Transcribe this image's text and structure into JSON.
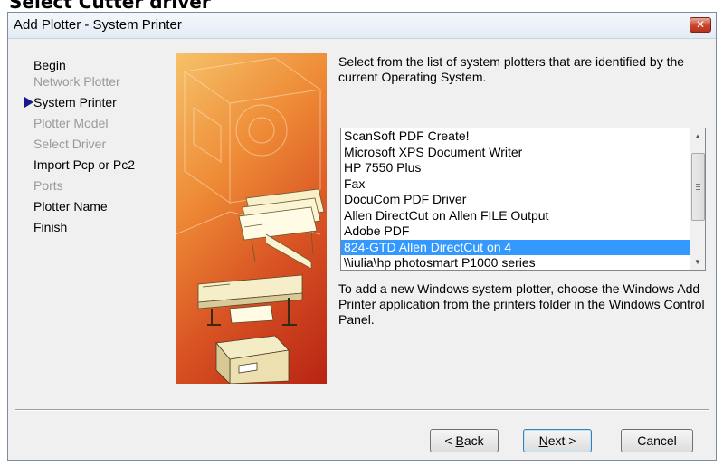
{
  "page_heading": "Select Cutter driver",
  "window": {
    "title": "Add Plotter - System Printer",
    "close_glyph": "✕"
  },
  "steps": [
    {
      "label": "Begin",
      "state": "active"
    },
    {
      "label": "Network Plotter",
      "state": "inactive"
    },
    {
      "label": "System Printer",
      "state": "current"
    },
    {
      "label": "Plotter Model",
      "state": "inactive"
    },
    {
      "label": "Select Driver",
      "state": "inactive"
    },
    {
      "label": "Import Pcp or Pc2",
      "state": "active"
    },
    {
      "label": "Ports",
      "state": "inactive"
    },
    {
      "label": "Plotter Name",
      "state": "active"
    },
    {
      "label": "Finish",
      "state": "active"
    }
  ],
  "intro_text": "Select from the list of system plotters that are identified by the current Operating System.",
  "plotter_list": {
    "items": [
      "ScanSoft PDF Create!",
      "Microsoft XPS Document Writer",
      "HP 7550 Plus",
      "Fax",
      "DocuCom PDF Driver",
      "Allen DirectCut on Allen FILE Output",
      "Adobe PDF",
      "824-GTD Allen DirectCut on 4",
      "\\\\iulia\\hp photosmart P1000 series"
    ],
    "selected": "824-GTD Allen DirectCut on 4"
  },
  "note_text": "To add a new Windows system plotter, choose the Windows Add Printer application from the printers folder in the Windows Control Panel.",
  "buttons": {
    "back_mnemonic": "B",
    "back_rest": "ack",
    "back_prefix": "< ",
    "next_mnemonic": "N",
    "next_rest": "ext >",
    "cancel": "Cancel"
  },
  "colors": {
    "selection": "#3399ff",
    "art_gradient": [
      "#f6c26a",
      "#b82414"
    ],
    "close_button": "#c7452c"
  }
}
